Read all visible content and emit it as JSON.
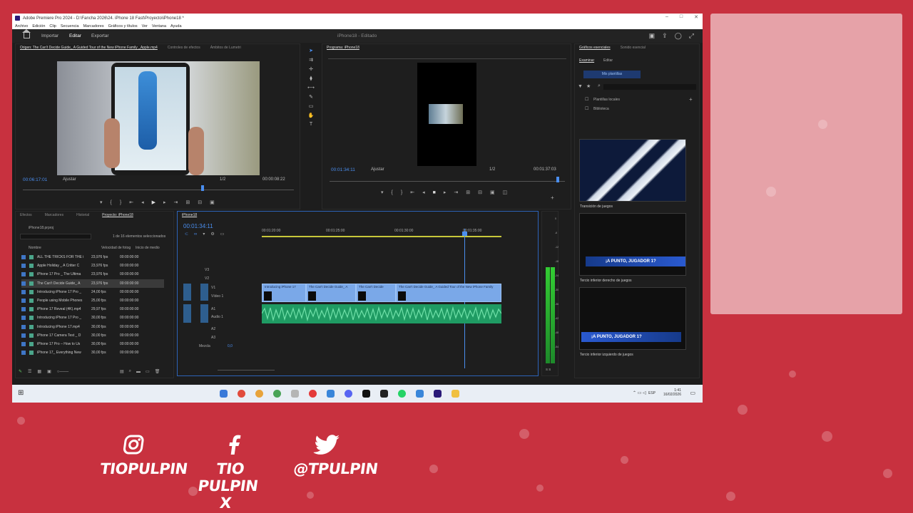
{
  "window": {
    "title": "Adobe Premiere Pro 2024 - D:\\Fancha 2026\\24. iPhone 18 Fast\\Proyecto\\iPhone18 *",
    "controls": [
      "–",
      "□",
      "✕"
    ]
  },
  "menu": [
    "Archivo",
    "Edición",
    "Clip",
    "Secuencia",
    "Marcadores",
    "Gráficos y títulos",
    "Ver",
    "Ventana",
    "Ayuda"
  ],
  "header": {
    "tabs": [
      "Importar",
      "Editar",
      "Exportar"
    ],
    "active_tab": "Editar",
    "project_title": "iPhone18 - Editado"
  },
  "source": {
    "tabs": [
      "Origen: The Can't Decide Guide_ A Guided Tour of the New iPhone Family _Apple.mp4",
      "Controles de efectos",
      "Ámbitos de Lumetri"
    ],
    "timecode": "00:06:17:01",
    "fit": "Ajustar",
    "ratio": "1/2",
    "duration": "00:00:08:22"
  },
  "program": {
    "tab": "Programa: iPhone18",
    "timecode": "00:01:34:11",
    "fit": "Ajustar",
    "ratio": "1/2",
    "duration": "00:01:37:03"
  },
  "project": {
    "tabs": [
      "Efectos",
      "Marcadores",
      "Historial",
      "Proyecto: iPhone18"
    ],
    "file": "iPhone18.prproj",
    "selection_status": "1 de 16 elementos seleccionados",
    "columns": [
      "Nombre",
      "Velocidad de fotog",
      "Inicio de medio"
    ],
    "rows": [
      {
        "name": "ALL THE TRICKS FOR THE i",
        "fps": "23,976 fps",
        "start": "00:00:00:00"
      },
      {
        "name": "Apple Holiday _ A Critter C",
        "fps": "23,976 fps",
        "start": "00:00:00:00"
      },
      {
        "name": "iPhone 17 Pro _ The Ultima",
        "fps": "23,976 fps",
        "start": "00:00:00:00"
      },
      {
        "name": "The Can't Decide Guide_ A",
        "fps": "23,976 fps",
        "start": "00:00:00:00"
      },
      {
        "name": "Introducing iPhone 17 Pro _",
        "fps": "24,00 fps",
        "start": "00:00:00:00"
      },
      {
        "name": "People using Mobile Phones",
        "fps": "25,00 fps",
        "start": "00:00:00:00"
      },
      {
        "name": "iPhone 17 Reveal (4K).mp4",
        "fps": "29,97 fps",
        "start": "00:00:00:00"
      },
      {
        "name": "Introducing iPhone 17 Pro _",
        "fps": "30,00 fps",
        "start": "00:00:00:00"
      },
      {
        "name": "Introducing iPhone 17.mp4",
        "fps": "30,00 fps",
        "start": "00:00:00:00"
      },
      {
        "name": "iPhone 17 Camera Test _ D",
        "fps": "30,00 fps",
        "start": "00:00:00:00"
      },
      {
        "name": "iPhone 17 Pro – How to Us",
        "fps": "30,00 fps",
        "start": "00:00:00:00"
      },
      {
        "name": "iPhone 17_ Everything New",
        "fps": "30,00 fps",
        "start": "00:00:00:00"
      }
    ]
  },
  "timeline": {
    "tab": "iPhone18",
    "timecode": "00:01:34:11",
    "ruler": [
      "00:01:20:00",
      "00:01:25:00",
      "00:01:30:00",
      "00:01:35:00"
    ],
    "tracks": {
      "video": [
        "V3",
        "V2",
        "V1"
      ],
      "video1_name": "Vídeo 1",
      "audio": [
        "A1",
        "A2",
        "A3"
      ],
      "audio1_name": "Audio 1",
      "mix_label": "Mezcla",
      "mix_value": "0,0"
    },
    "clips": [
      "Introducing iPhone 17",
      "The Can't Decide Guide_ A",
      "The Can't Decide",
      "The Can't Decide Guide_ A Guided Tour of the New iPhone Family"
    ],
    "meter_labels": [
      "0",
      "-6",
      "-12",
      "-18",
      "-24",
      "-30",
      "-36",
      "-42",
      "-48",
      "-54"
    ],
    "meter_footer": "S S"
  },
  "graphics": {
    "tabs": [
      "Gráficos esenciales",
      "Sonido esencial"
    ],
    "subtabs": [
      "Examinar",
      "Editar"
    ],
    "my_templates": "Mis plantillas",
    "tree": [
      "Plantillas locales",
      "Biblioteca"
    ],
    "cards": [
      {
        "caption": "Transición de juegos"
      },
      {
        "caption": "Tercio inferior derecho de juegos",
        "text": "¡A PUNTO, JUGADOR 1?"
      },
      {
        "caption": "Tercio inferior izquierdo de juegos",
        "text": "¡A PUNTO, JUGADOR 1?"
      }
    ]
  },
  "taskbar": {
    "time": "1:41",
    "date": "16/02/2026",
    "lang": "ESP"
  },
  "socials": [
    {
      "icon": "instagram-icon",
      "handle": "TIOPULPIN"
    },
    {
      "icon": "facebook-icon",
      "handle": "TIO PULPIN X"
    },
    {
      "icon": "twitter-icon",
      "handle": "@TPULPIN"
    }
  ],
  "colors": {
    "background": "#c8313f",
    "accent": "#4a8eef",
    "audio_clip": "#1f9b63",
    "video_clip": "#7aa8e8"
  }
}
